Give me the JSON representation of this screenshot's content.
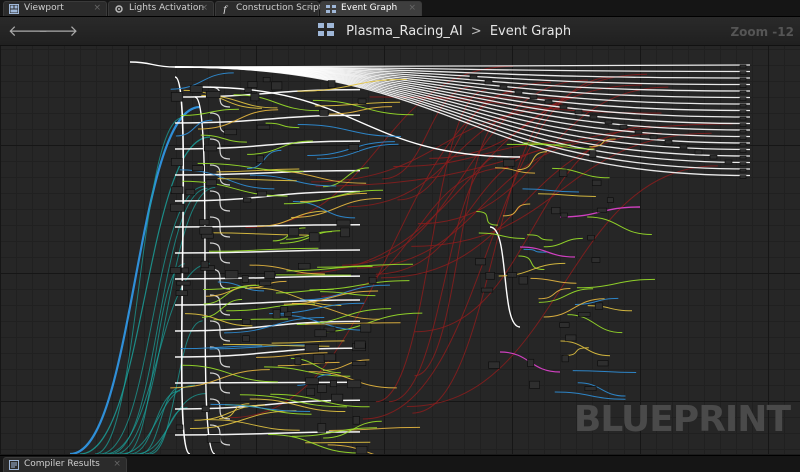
{
  "tabs": [
    {
      "label": "Viewport",
      "icon": "viewport-icon",
      "active": false
    },
    {
      "label": "Lights Activation",
      "icon": "gear-icon",
      "active": false
    },
    {
      "label": "Construction Script",
      "icon": "function-icon",
      "active": false
    },
    {
      "label": "Event Graph",
      "icon": "event-graph-icon",
      "active": true
    }
  ],
  "breadcrumb": {
    "blueprint": "Plasma_Racing_AI",
    "separator": ">",
    "graph": "Event Graph"
  },
  "zoom_label": "Zoom -12",
  "watermark": "BLUEPRINT",
  "bottom_tab": {
    "label": "Compiler Results"
  },
  "colors": {
    "exec_wire": "#ffffff",
    "object_wire": "#2f8fd8",
    "float_wire": "#9ae12a",
    "struct_wire": "#e8b840",
    "vector_wire": "#e3c441",
    "bool_wire": "#8a1d1d",
    "teal_wire": "#1aa6a0",
    "pink_wire": "#d040c0",
    "accent_tab": "#3e3e3e"
  }
}
